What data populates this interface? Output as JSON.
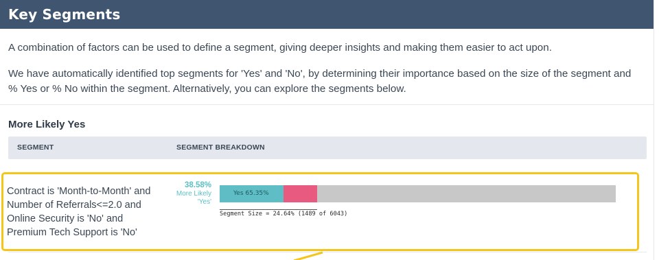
{
  "header": {
    "title": "Key Segments"
  },
  "description": {
    "p1": "A combination of factors can be used to define a segment, giving deeper insights and making them easier to act upon.",
    "p2": "We have automatically identified top segments for 'Yes' and 'No', by determining their importance based on the size of the segment and % Yes or % No within the segment. Alternatively, you can explore the segments below."
  },
  "section": {
    "title": "More Likely Yes"
  },
  "table": {
    "headers": {
      "segment": "SEGMENT",
      "breakdown": "SEGMENT BREAKDOWN"
    },
    "rows": [
      {
        "segment_lines": [
          "Contract is 'Month-to-Month' and",
          "Number of Referrals<=2.0 and",
          "Online Security is 'No' and",
          "Premium Tech Support is 'No'"
        ],
        "likely_pct": "38.58%",
        "likely_label_1": "More Likely",
        "likely_label_2": "'Yes'",
        "yes_label": "Yes 65.35%",
        "yes_fraction": 0.6535,
        "segment_size_fraction": 0.2464,
        "segment_size_text": "Segment Size = 24.64% (1489 of 6043)"
      }
    ]
  },
  "colors": {
    "header_bg": "#3f5570",
    "yes": "#5fbdc5",
    "no": "#e85a80",
    "remainder": "#c8c8c8",
    "highlight": "#f6c51c",
    "likely_text": "#5bbfc4"
  }
}
